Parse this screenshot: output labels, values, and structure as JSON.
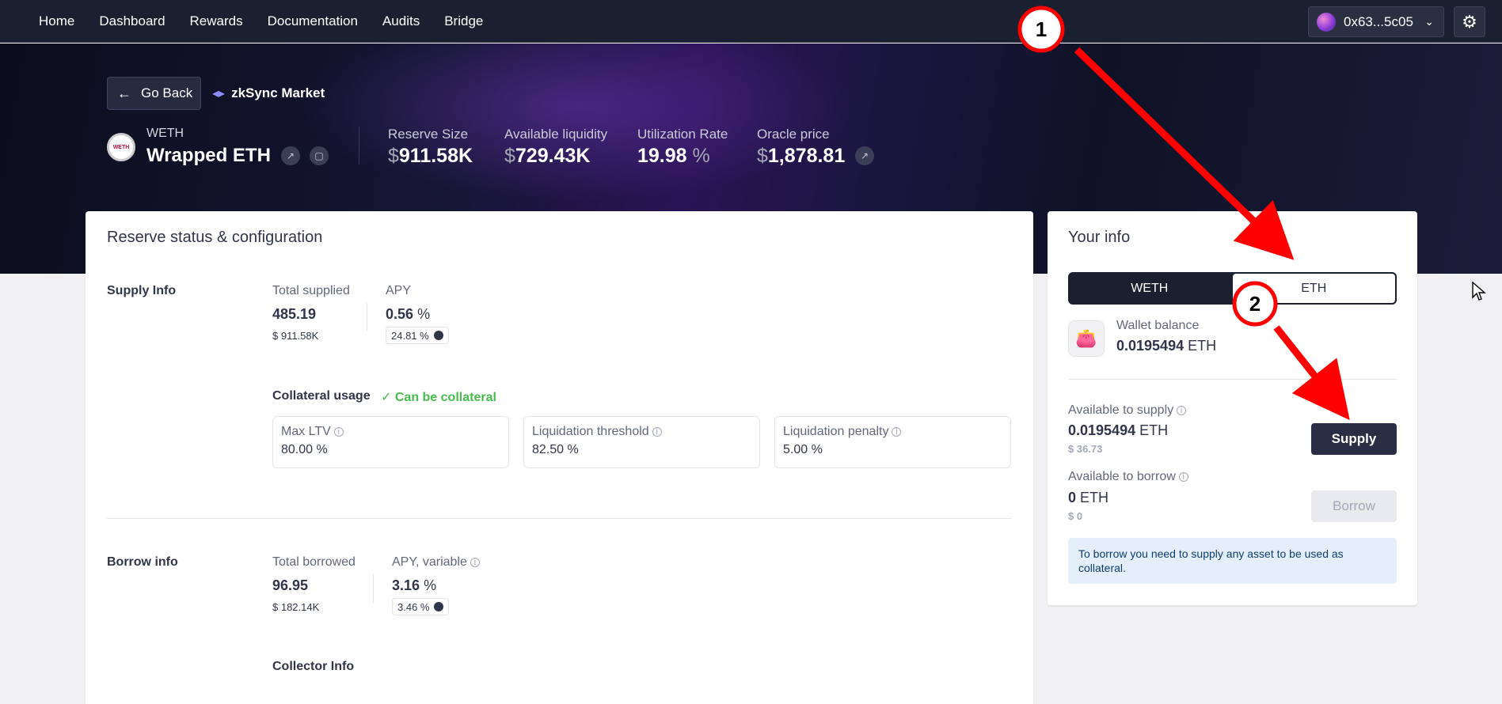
{
  "nav": {
    "items": [
      {
        "label": "Home"
      },
      {
        "label": "Dashboard"
      },
      {
        "label": "Rewards"
      },
      {
        "label": "Documentation"
      },
      {
        "label": "Audits"
      },
      {
        "label": "Bridge"
      }
    ],
    "wallet_address": "0x63...5c05",
    "wallet_icon": "chevron-down-icon",
    "settings_icon": "gear-icon"
  },
  "hero": {
    "go_back_label": "Go Back",
    "market_name": "zkSync Market",
    "asset_logo_text": "WETH",
    "asset_symbol": "WETH",
    "asset_name": "Wrapped ETH",
    "stats": {
      "reserve_size": {
        "label": "Reserve Size",
        "currency": "$",
        "value": "911.58K"
      },
      "available_liquidity": {
        "label": "Available liquidity",
        "currency": "$",
        "value": "729.43K"
      },
      "utilization_rate": {
        "label": "Utilization Rate",
        "value": "19.98",
        "unit": "%"
      },
      "oracle_price": {
        "label": "Oracle price",
        "currency": "$",
        "value": "1,878.81"
      }
    }
  },
  "reserve": {
    "title": "Reserve status & configuration",
    "supply": {
      "section_label": "Supply Info",
      "total_supplied_label": "Total supplied",
      "total_supplied": "485.19",
      "total_supplied_usd": "$ 911.58K",
      "apy_label": "APY",
      "apy": "0.56",
      "apy_unit": "%",
      "incentive": "24.81 %",
      "collateral_label": "Collateral usage",
      "collateral_status": "Can be collateral",
      "max_ltv_label": "Max LTV",
      "max_ltv": "80.00 %",
      "liq_threshold_label": "Liquidation threshold",
      "liq_threshold": "82.50 %",
      "liq_penalty_label": "Liquidation penalty",
      "liq_penalty": "5.00 %"
    },
    "borrow": {
      "section_label": "Borrow info",
      "total_borrowed_label": "Total borrowed",
      "total_borrowed": "96.95",
      "total_borrowed_usd": "$ 182.14K",
      "apy_label": "APY, variable",
      "apy": "3.16",
      "apy_unit": "%",
      "incentive": "3.46 %"
    },
    "collector_label": "Collector Info"
  },
  "your_info": {
    "title": "Your info",
    "tabs": [
      {
        "label": "WETH"
      },
      {
        "label": "ETH"
      }
    ],
    "selected_tab": "ETH",
    "wallet_balance_label": "Wallet balance",
    "wallet_balance": "0.0195494",
    "wallet_balance_unit": "ETH",
    "available_supply_label": "Available to supply",
    "available_supply": "0.0195494",
    "available_supply_unit": "ETH",
    "available_supply_usd": "$ 36.73",
    "supply_button": "Supply",
    "available_borrow_label": "Available to borrow",
    "available_borrow": "0",
    "available_borrow_unit": "ETH",
    "available_borrow_usd": "$ 0",
    "borrow_button": "Borrow",
    "notice": "To borrow you need to supply any asset to be used as collateral."
  },
  "annotations": {
    "step1": "1",
    "step2": "2",
    "color": "#ff0000"
  }
}
